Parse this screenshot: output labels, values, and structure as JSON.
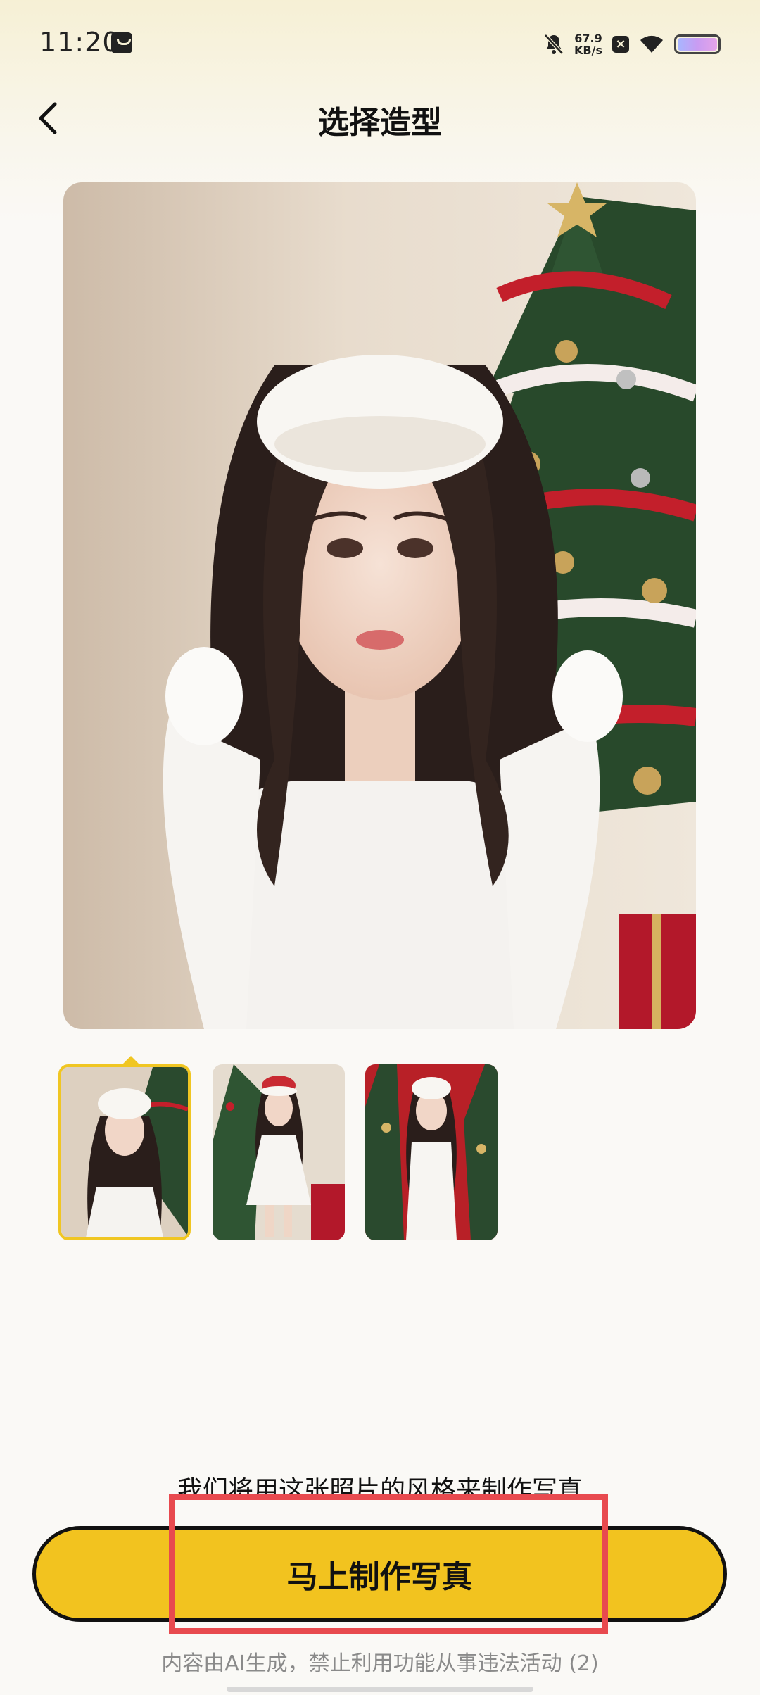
{
  "status_bar": {
    "time": "11:20",
    "net_speed_value": "67.9",
    "net_speed_unit": "KB/s"
  },
  "header": {
    "title": "选择造型",
    "back_icon": "chevron-left-icon"
  },
  "styles": {
    "selected_index": 0,
    "items": [
      {
        "label": "style-1"
      },
      {
        "label": "style-2"
      },
      {
        "label": "style-3"
      }
    ]
  },
  "footer": {
    "notice": "我们将用这张照片的风格来制作写真",
    "action_label": "马上制作写真",
    "disclaimer": "内容由AI生成，禁止利用功能从事违法活动 (2)"
  },
  "colors": {
    "accent": "#f2c31f",
    "highlight": "#e84a4f"
  }
}
